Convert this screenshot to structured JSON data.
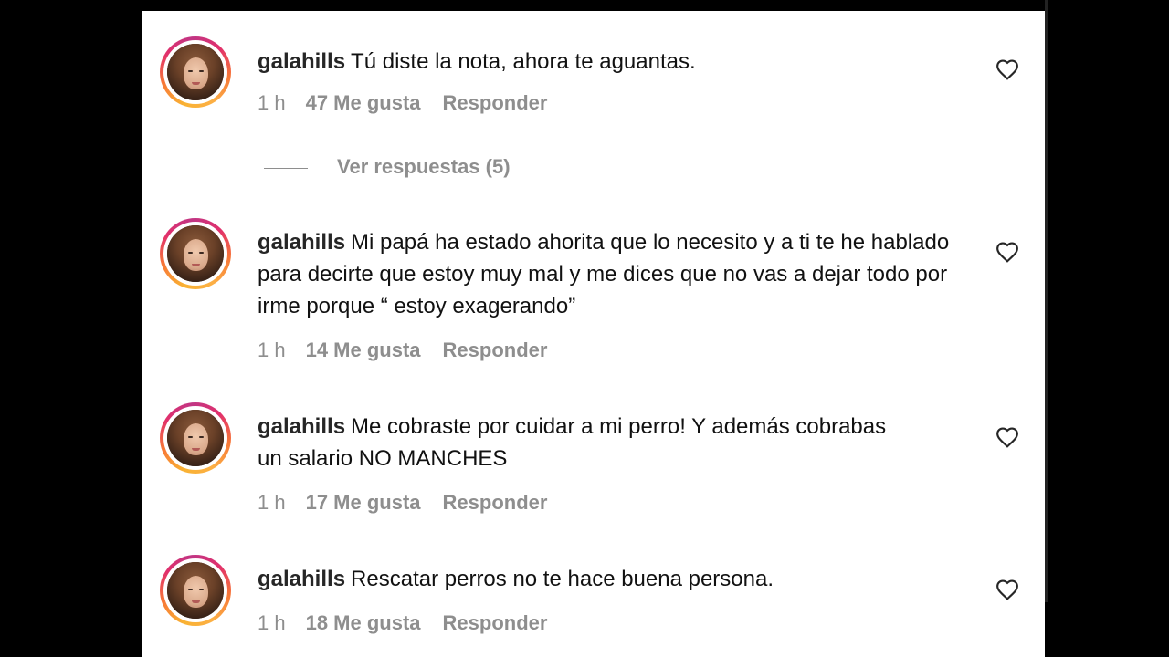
{
  "comments": [
    {
      "username": "galahills",
      "text": "Tú diste la nota, ahora te aguantas.",
      "time": "1 h",
      "likes": "47 Me gusta",
      "reply": "Responder",
      "view_replies": "Ver respuestas (5)"
    },
    {
      "username": "galahills",
      "text": "Mi papá ha estado ahorita que lo necesito y a ti te he hablado para decirte que estoy muy mal y me dices que no vas a dejar todo por irme porque “ estoy exagerando”",
      "time": "1 h",
      "likes": "14 Me gusta",
      "reply": "Responder"
    },
    {
      "username": "galahills",
      "text": "Me cobraste por cuidar a mi perro! Y además cobrabas un salario NO MANCHES",
      "time": "1 h",
      "likes": "17 Me gusta",
      "reply": "Responder"
    },
    {
      "username": "galahills",
      "text": "Rescatar perros no te hace buena persona.",
      "time": "1 h",
      "likes": "18 Me gusta",
      "reply": "Responder"
    }
  ],
  "icons": {
    "like": "heart-outline-icon",
    "avatar_ring_colors": [
      "#f9b233",
      "#f77737",
      "#e1306c",
      "#c13584"
    ]
  }
}
